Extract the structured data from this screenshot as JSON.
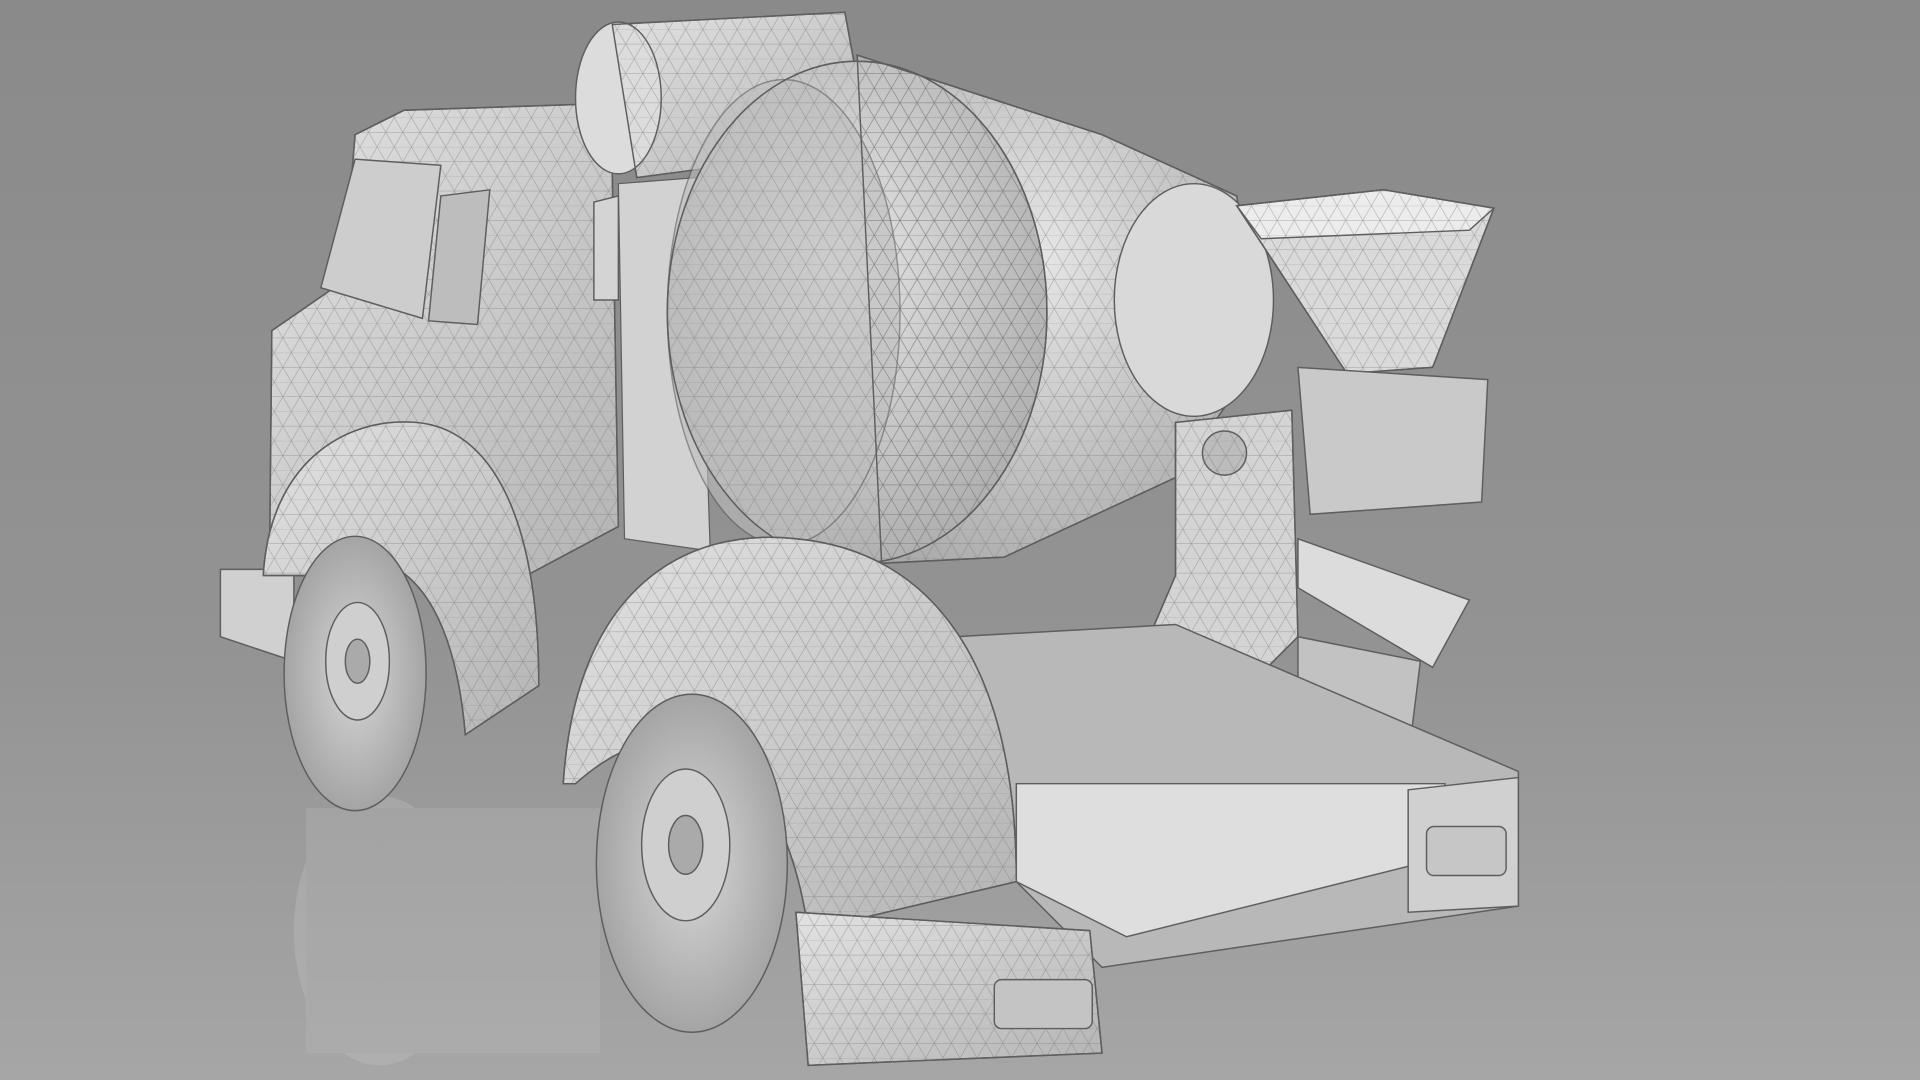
{
  "scene": {
    "subject": "cement-mixer-truck-render",
    "colors": {
      "background_top": "#8c8c8c",
      "background_bottom": "#a4a4a4",
      "model_light": "#e4e4e4",
      "model_mid": "#c8c8c8",
      "model_dark": "#9c9c9c",
      "wire": "#6f6f6f"
    }
  }
}
